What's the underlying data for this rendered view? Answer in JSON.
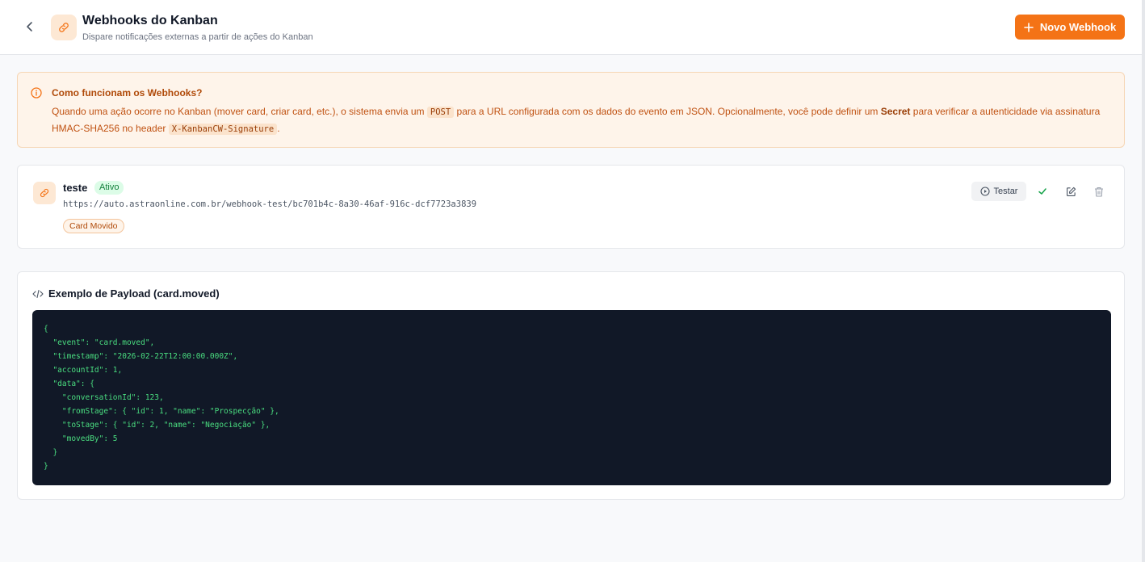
{
  "header": {
    "title": "Webhooks do Kanban",
    "subtitle": "Dispare notificações externas a partir de ações do Kanban",
    "new_button": "Novo Webhook"
  },
  "info": {
    "title": "Como funcionam os Webhooks?",
    "text_1": "Quando uma ação ocorre no Kanban (mover card, criar card, etc.), o sistema envia um",
    "code_1": "POST",
    "text_2": "para a URL configurada com os dados do evento em JSON. Opcionalmente, você pode definir um",
    "strong_1": "Secret",
    "text_3": "para verificar a autenticidade via assinatura HMAC-SHA256 no header",
    "code_2": "X-KanbanCW-Signature",
    "text_4": "."
  },
  "webhook": {
    "name": "teste",
    "status": "Ativo",
    "url": "https://auto.astraonline.com.br/webhook-test/bc701b4c-8a30-46af-916c-dcf7723a3839",
    "event": "Card Movido",
    "test_button": "Testar"
  },
  "payload": {
    "title": "Exemplo de Payload (card.moved)",
    "lines": [
      "{",
      "  \"event\": \"card.moved\",",
      "  \"timestamp\": \"2026-02-22T12:00:00.000Z\",",
      "  \"accountId\": 1,",
      "  \"data\": {",
      "    \"conversationId\": 123,",
      "    \"fromStage\": { \"id\": 1, \"name\": \"Prospecção\" },",
      "    \"toStage\": { \"id\": 2, \"name\": \"Negociação\" },",
      "    \"movedBy\": 5",
      "  }",
      "}"
    ]
  },
  "icons": {
    "back": "chevron-left-icon",
    "link": "link-icon",
    "plus": "plus-icon",
    "info": "info-icon",
    "play": "play-circle-icon",
    "check": "check-icon",
    "edit": "edit-icon",
    "trash": "trash-icon",
    "code": "code-icon"
  },
  "colors": {
    "accent": "#f47316",
    "info_bg": "#fef4ea",
    "status_green": "#15803d",
    "code_bg": "#111827",
    "code_text": "#4ade80"
  }
}
